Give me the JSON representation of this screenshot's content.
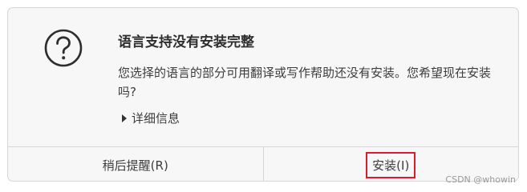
{
  "dialog": {
    "title": "语言支持没有安装完整",
    "message": "您选择的语言的部分可用翻译或写作帮助还没有安装。您希望现在安装吗?",
    "details_label": "详细信息",
    "icon": "question-icon"
  },
  "buttons": {
    "later_label": "稍后提醒(R)",
    "install_label": "安装(I)"
  },
  "watermark": "CSDN @whowin",
  "colors": {
    "highlight_border": "#e0192f",
    "dialog_background": "#f7f7f7"
  }
}
